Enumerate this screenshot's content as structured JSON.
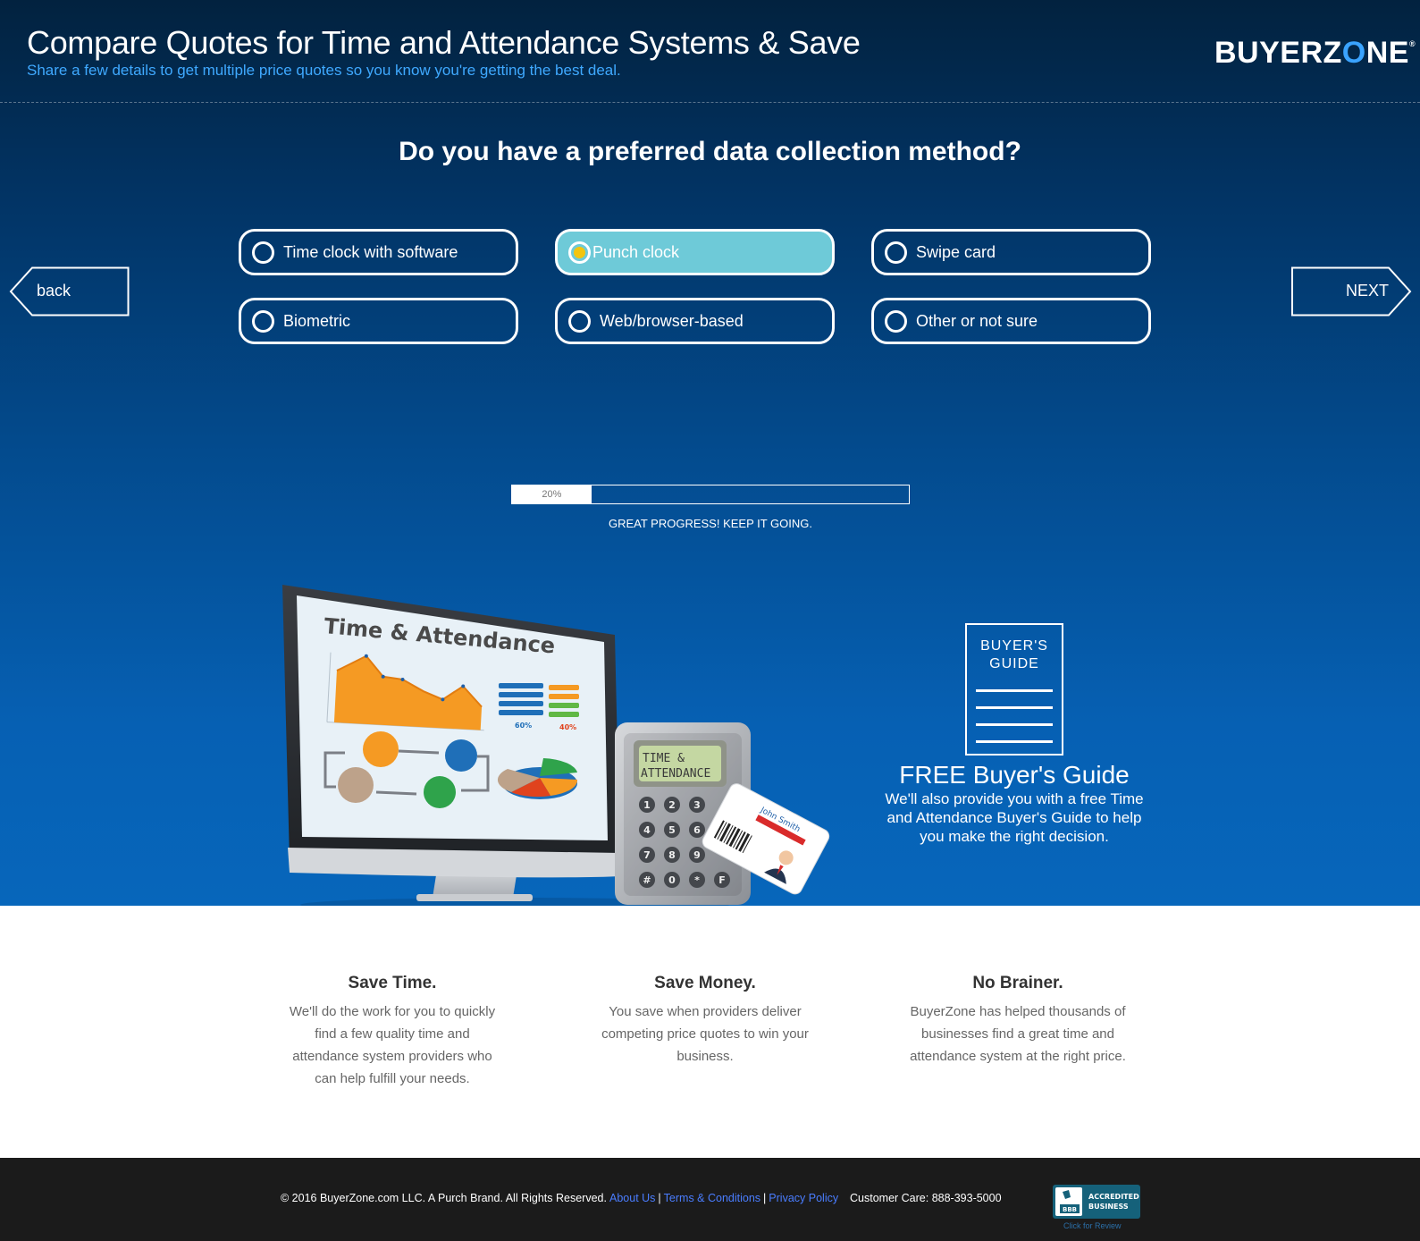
{
  "header": {
    "title": "Compare Quotes for Time and Attendance Systems & Save",
    "subtitle": "Share a few details to get multiple price quotes so you know you're getting the best deal.",
    "logo_text": "BUYERZONE"
  },
  "question": {
    "text": "Do you have a preferred data collection method?",
    "options": [
      {
        "label": "Time clock with software",
        "selected": false
      },
      {
        "label": "Punch clock",
        "selected": true
      },
      {
        "label": "Swipe card",
        "selected": false
      },
      {
        "label": "Biometric",
        "selected": false
      },
      {
        "label": "Web/browser-based",
        "selected": false
      },
      {
        "label": "Other or not sure",
        "selected": false
      }
    ]
  },
  "nav": {
    "back_label": "back",
    "next_label": "NEXT"
  },
  "progress": {
    "value": 0.2,
    "label": "20%",
    "message": "GREAT PROGRESS! KEEP IT GOING."
  },
  "illustration": {
    "screen_title": "Time & Attendance",
    "stat_left": "60%",
    "stat_right": "40%",
    "keypad_display_line1": "TIME &",
    "keypad_display_line2": "ATTENDANCE",
    "keys": [
      "1",
      "2",
      "3",
      "4",
      "5",
      "6",
      "7",
      "8",
      "9",
      "#",
      "0",
      "*",
      "F"
    ],
    "badge_name": "John Smith"
  },
  "guide": {
    "doc_label_line1": "BUYER'S",
    "doc_label_line2": "GUIDE",
    "title": "FREE Buyer's Guide",
    "text": "We'll also provide you with a free Time and Attendance Buyer's Guide to help you make the right decision."
  },
  "features": [
    {
      "title": "Save Time.",
      "text": "We'll do the work for you to quickly find a few quality time and attendance system providers who can help fulfill your needs."
    },
    {
      "title": "Save Money.",
      "text": "You save when providers deliver competing price quotes to win your business."
    },
    {
      "title": "No Brainer.",
      "text": "BuyerZone has helped thousands of businesses find a great time and attendance system at the right price."
    }
  ],
  "footer": {
    "copyright": "© 2016 BuyerZone.com LLC. A Purch Brand. All Rights Reserved.",
    "links": [
      "About Us",
      "Terms & Conditions",
      "Privacy Policy"
    ],
    "separator": "|",
    "customer_care": "Customer Care: 888-393-5000",
    "bbb_line1": "ACCREDITED",
    "bbb_line2": "BUSINESS",
    "bbb_caption": "Click for Review"
  },
  "colors": {
    "hero_top": "#02223f",
    "hero_bottom": "#0766bb",
    "subtitle_blue": "#3fa9ff",
    "selected_option": "#6ecad8",
    "selected_dot": "#f3c50e",
    "footer_bg": "#1b1b1b",
    "link_blue": "#4a7dff"
  }
}
